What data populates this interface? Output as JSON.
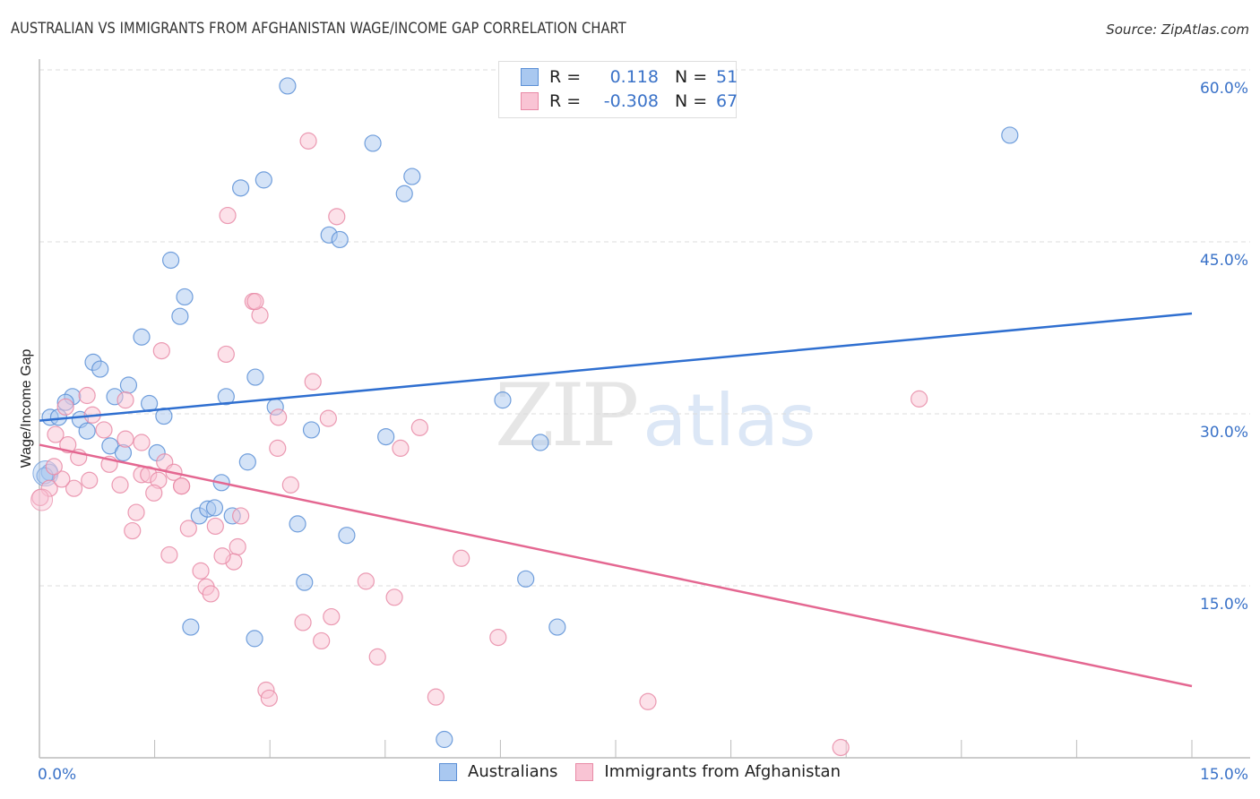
{
  "header": {
    "title": "AUSTRALIAN VS IMMIGRANTS FROM AFGHANISTAN WAGE/INCOME GAP CORRELATION CHART",
    "source": "Source: ZipAtlas.com"
  },
  "watermark": {
    "zip": "ZIP",
    "atlas": "atlas"
  },
  "legend": {
    "rows": [
      {
        "r_label": "R =",
        "r_value": "0.118",
        "n_label": "N =",
        "n_value": "51",
        "color": "#a9c8f0",
        "border": "#5b8fd6"
      },
      {
        "r_label": "R =",
        "r_value": "-0.308",
        "n_label": "N =",
        "n_value": "67",
        "color": "#f9c4d4",
        "border": "#e88aa6"
      }
    ]
  },
  "bottom_legend": [
    {
      "label": "Australians"
    },
    {
      "label": "Immigrants from Afghanistan"
    }
  ],
  "colors": {
    "blue_fill": "#a9c8f0",
    "blue_stroke": "#5b8fd6",
    "blue_line": "#2f6fd0",
    "pink_fill": "#f9c4d4",
    "pink_stroke": "#e88aa6",
    "pink_line": "#e46791",
    "axis_label": "#3a72c8"
  },
  "chart_data": {
    "type": "scatter",
    "title": "AUSTRALIAN VS IMMIGRANTS FROM AFGHANISTAN WAGE/INCOME GAP CORRELATION CHART",
    "xlabel": "",
    "ylabel": "Wage/Income Gap",
    "xlim": [
      0,
      15
    ],
    "ylim": [
      0,
      62
    ],
    "x_tick_labels": [
      "0.0%",
      "15.0%"
    ],
    "y_ticks": [
      15,
      30,
      45,
      60
    ],
    "y_tick_labels": [
      "15.0%",
      "30.0%",
      "45.0%",
      "60.0%"
    ],
    "grid": "horizontal dashed",
    "legend_position": "top-center and bottom",
    "series": [
      {
        "name": "Australians",
        "R": 0.118,
        "N": 51,
        "trend": {
          "x": [
            0,
            15
          ],
          "y": [
            29.4,
            38.75
          ]
        },
        "points": [
          [
            3.23,
            58.6
          ],
          [
            12.63,
            54.3
          ],
          [
            4.34,
            53.6
          ],
          [
            4.85,
            50.7
          ],
          [
            2.92,
            50.4
          ],
          [
            2.62,
            49.7
          ],
          [
            4.75,
            49.2
          ],
          [
            3.77,
            45.6
          ],
          [
            3.91,
            45.2
          ],
          [
            1.71,
            43.4
          ],
          [
            1.89,
            40.2
          ],
          [
            1.83,
            38.5
          ],
          [
            1.33,
            36.7
          ],
          [
            0.7,
            34.5
          ],
          [
            0.79,
            33.9
          ],
          [
            2.81,
            33.2
          ],
          [
            1.16,
            32.5
          ],
          [
            0.98,
            31.5
          ],
          [
            1.43,
            30.9
          ],
          [
            0.43,
            31.5
          ],
          [
            0.34,
            31.0
          ],
          [
            2.43,
            31.5
          ],
          [
            3.07,
            30.6
          ],
          [
            6.03,
            31.2
          ],
          [
            0.14,
            29.7
          ],
          [
            0.25,
            29.7
          ],
          [
            0.53,
            29.5
          ],
          [
            1.62,
            29.8
          ],
          [
            3.54,
            28.6
          ],
          [
            4.51,
            28.0
          ],
          [
            6.52,
            27.5
          ],
          [
            0.62,
            28.5
          ],
          [
            0.92,
            27.2
          ],
          [
            1.09,
            26.6
          ],
          [
            1.53,
            26.6
          ],
          [
            2.71,
            25.8
          ],
          [
            2.37,
            24.0
          ],
          [
            0.13,
            24.9
          ],
          [
            0.07,
            24.6
          ],
          [
            2.08,
            21.1
          ],
          [
            2.19,
            21.7
          ],
          [
            2.28,
            21.8
          ],
          [
            2.51,
            21.1
          ],
          [
            3.36,
            20.4
          ],
          [
            4.0,
            19.4
          ],
          [
            6.33,
            15.6
          ],
          [
            3.45,
            15.3
          ],
          [
            1.97,
            11.4
          ],
          [
            6.74,
            11.4
          ],
          [
            2.8,
            10.4
          ],
          [
            5.27,
            1.6
          ]
        ]
      },
      {
        "name": "Immigrants from Afghanistan",
        "R": -0.308,
        "N": 67,
        "trend": {
          "x": [
            0,
            15
          ],
          "y": [
            27.3,
            6.25
          ]
        },
        "points": [
          [
            3.5,
            53.8
          ],
          [
            2.45,
            47.3
          ],
          [
            3.87,
            47.2
          ],
          [
            2.78,
            39.8
          ],
          [
            2.87,
            38.6
          ],
          [
            1.59,
            35.5
          ],
          [
            2.43,
            35.2
          ],
          [
            3.56,
            32.8
          ],
          [
            0.62,
            31.6
          ],
          [
            1.12,
            31.2
          ],
          [
            0.34,
            30.6
          ],
          [
            0.69,
            29.9
          ],
          [
            3.11,
            29.7
          ],
          [
            3.76,
            29.6
          ],
          [
            4.95,
            28.8
          ],
          [
            11.45,
            31.3
          ],
          [
            0.21,
            28.2
          ],
          [
            0.84,
            28.6
          ],
          [
            0.37,
            27.3
          ],
          [
            1.33,
            27.5
          ],
          [
            3.1,
            27.0
          ],
          [
            4.7,
            27.0
          ],
          [
            0.51,
            26.2
          ],
          [
            0.91,
            25.6
          ],
          [
            1.63,
            25.8
          ],
          [
            1.75,
            24.9
          ],
          [
            1.33,
            24.7
          ],
          [
            1.42,
            24.7
          ],
          [
            1.55,
            24.2
          ],
          [
            1.85,
            23.7
          ],
          [
            1.05,
            23.8
          ],
          [
            0.45,
            23.5
          ],
          [
            0.13,
            23.5
          ],
          [
            0.29,
            24.3
          ],
          [
            3.27,
            23.8
          ],
          [
            1.85,
            23.7
          ],
          [
            1.49,
            23.1
          ],
          [
            0.01,
            22.7
          ],
          [
            1.26,
            21.4
          ],
          [
            1.21,
            19.8
          ],
          [
            1.94,
            20.0
          ],
          [
            2.29,
            20.2
          ],
          [
            2.62,
            21.1
          ],
          [
            2.58,
            18.4
          ],
          [
            1.69,
            17.7
          ],
          [
            5.49,
            17.4
          ],
          [
            2.1,
            16.3
          ],
          [
            2.53,
            17.1
          ],
          [
            2.17,
            14.9
          ],
          [
            4.25,
            15.4
          ],
          [
            2.23,
            14.3
          ],
          [
            4.62,
            14.0
          ],
          [
            3.8,
            12.3
          ],
          [
            3.43,
            11.8
          ],
          [
            5.97,
            10.5
          ],
          [
            3.67,
            10.2
          ],
          [
            4.4,
            8.8
          ],
          [
            2.95,
            5.9
          ],
          [
            2.99,
            5.2
          ],
          [
            5.16,
            5.3
          ],
          [
            7.92,
            4.9
          ],
          [
            10.43,
            0.9
          ],
          [
            2.38,
            17.6
          ],
          [
            0.19,
            25.4
          ],
          [
            1.12,
            27.8
          ],
          [
            2.81,
            39.8
          ],
          [
            0.65,
            24.2
          ]
        ]
      }
    ]
  }
}
